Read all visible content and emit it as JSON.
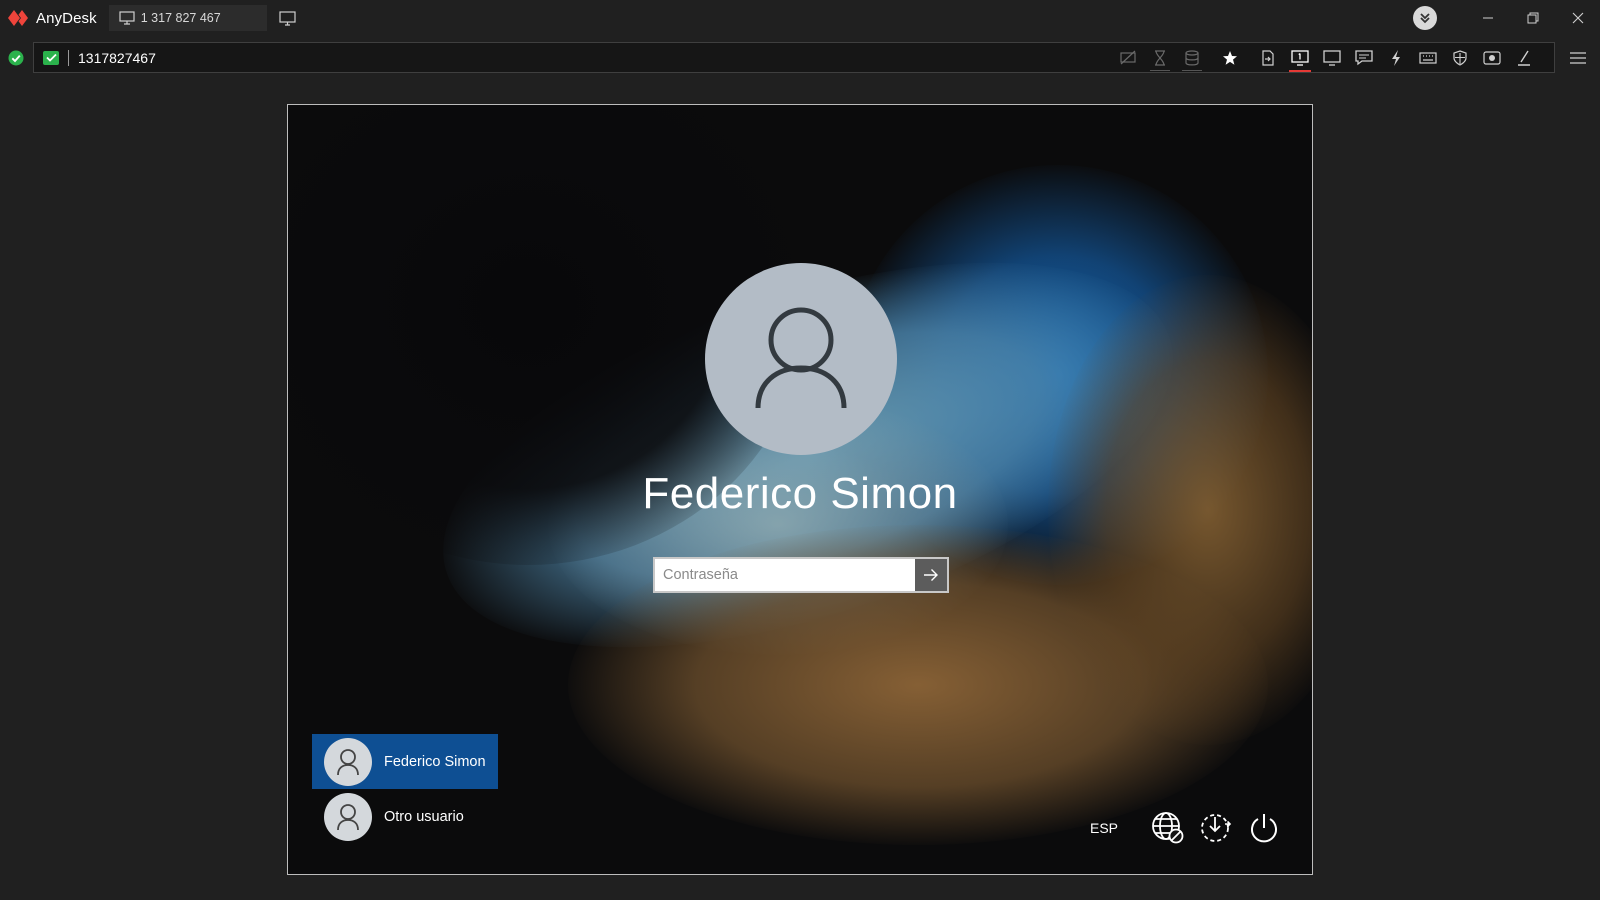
{
  "app": {
    "name": "AnyDesk",
    "session_tab_label": "1 317 827 467"
  },
  "address_bar": {
    "value": "1317827467",
    "status": "connected"
  },
  "toolbar": {
    "icons": [
      "privacy-mode-icon",
      "timer-icon",
      "database-icon",
      "favorite-star-icon",
      "file-transfer-icon",
      "monitor-1-icon",
      "display-icon",
      "chat-icon",
      "actions-icon",
      "keyboard-icon",
      "permissions-icon",
      "record-icon",
      "whiteboard-icon"
    ],
    "active_icon": "monitor-1-icon"
  },
  "login": {
    "user_name": "Federico Simon",
    "password_placeholder": "Contraseña",
    "users": [
      {
        "label": "Federico Simon",
        "selected": true
      },
      {
        "label": "Otro usuario",
        "selected": false
      }
    ],
    "language": "ESP"
  },
  "colors": {
    "brand_red": "#ef443b",
    "selected_user_bg": "#0e4f93",
    "status_green": "#2bb24c"
  }
}
